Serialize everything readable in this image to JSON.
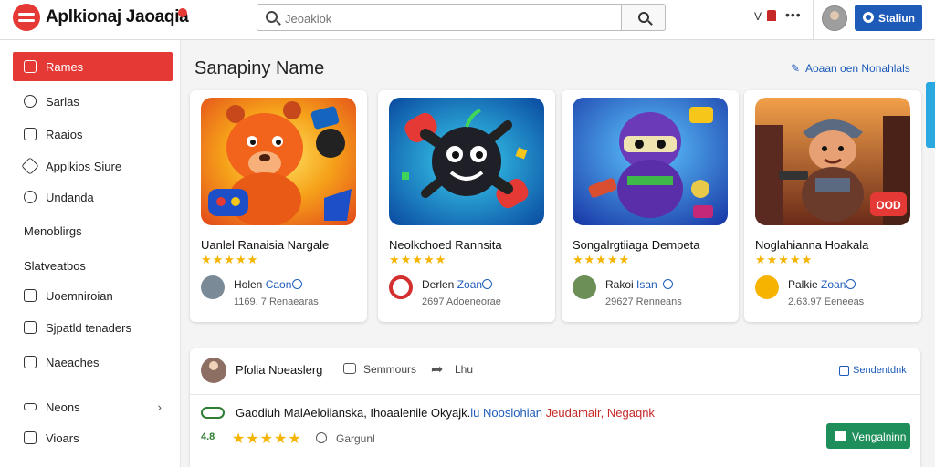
{
  "header": {
    "brand": "Aplkionaj Jaoaqia",
    "search_placeholder": "Jeoakiok",
    "v_label": "V",
    "dots": "•••",
    "action_button": "Staliun"
  },
  "sidebar": {
    "items": [
      {
        "label": "Rames",
        "icon": "list-icon",
        "active": true
      },
      {
        "label": "Sarlas",
        "icon": "compass-icon"
      },
      {
        "label": "Raaios",
        "icon": "box-icon"
      },
      {
        "label": "Applkios Siure",
        "icon": "tag-icon"
      },
      {
        "label": "Undanda",
        "icon": "people-icon"
      },
      {
        "label": "Menoblirgs",
        "icon": ""
      },
      {
        "label": "Slatveatbos",
        "icon": ""
      },
      {
        "label": "Uoemniroian",
        "icon": "video-icon"
      },
      {
        "label": "Sjpatld tenaders",
        "icon": "phone-icon"
      },
      {
        "label": "Naeaches",
        "icon": "square-icon"
      },
      {
        "label": "Neons",
        "icon": "menu-icon",
        "chevron": "›"
      },
      {
        "label": "Vioars",
        "icon": "check-icon"
      }
    ]
  },
  "main": {
    "section_title": "Sanapiny Name",
    "section_link": "Aoaan oen Nonahlals",
    "cards": [
      {
        "title": "Uanlel Ranaisia Nargale",
        "stars": "★★★★★",
        "dev_prefix": "Holen",
        "dev_highlight": "Caon",
        "meta": "1169. 7 Renaearas"
      },
      {
        "title": "Neolkchoed Rannsita",
        "stars": "★★★★★",
        "dev_prefix": "Derlen",
        "dev_highlight": "Zoan",
        "meta": "2697 Adoeneorae"
      },
      {
        "title": "Songalrgtiiaga Dempeta",
        "stars": "★★★★★",
        "dev_prefix": "Rakoi",
        "dev_highlight": "Isan",
        "meta": "29627 Renneans"
      },
      {
        "title": "Noglahianna Hoakala",
        "stars": "★★★★★",
        "dev_prefix": "Palkie",
        "dev_highlight": "Zoan",
        "meta": "2.63.97 Eeneeas"
      }
    ]
  },
  "panel": {
    "name": "Pfolia Noeaslerg",
    "comment": "Semmours",
    "share": "Lhu",
    "link": "Sendentdnk",
    "text_main": "Gaodiuh MalAeloiianska, Ihoaalenile Okyajk.",
    "text_blue": "lu Nooslohian",
    "text_red1": "Jeudamair,",
    "text_red2": "Negaqnk",
    "score": "4.8",
    "stars": "★★★★★",
    "tag": "Gargunl",
    "button": "Vengalninn"
  },
  "colors": {
    "accent_red": "#e53935",
    "primary_blue": "#1e5bb8",
    "success_green": "#1e8e5a",
    "star_gold": "#f5b400"
  }
}
